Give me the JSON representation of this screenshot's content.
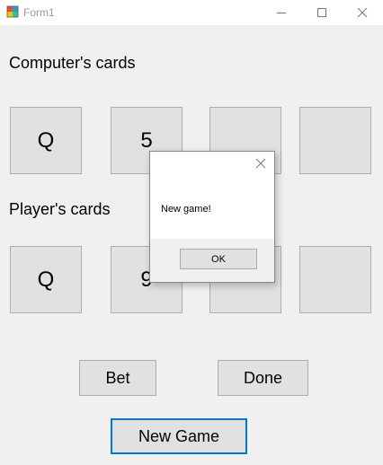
{
  "window": {
    "title": "Form1",
    "icon": "winforms-app-icon",
    "controls": {
      "minimize": "minimize-icon",
      "maximize": "maximize-icon",
      "close": "close-icon"
    }
  },
  "computer": {
    "label": "Computer's cards",
    "cards": [
      "Q",
      "5",
      "",
      ""
    ]
  },
  "player": {
    "label": "Player's cards",
    "cards": [
      "Q",
      "9",
      "",
      ""
    ]
  },
  "buttons": {
    "bet": "Bet",
    "done": "Done",
    "new_game": "New Game"
  },
  "dialog": {
    "message": "New game!",
    "ok": "OK"
  },
  "colors": {
    "accent": "#0078d7",
    "control": "#e1e1e1",
    "form": "#f0f0f0"
  }
}
